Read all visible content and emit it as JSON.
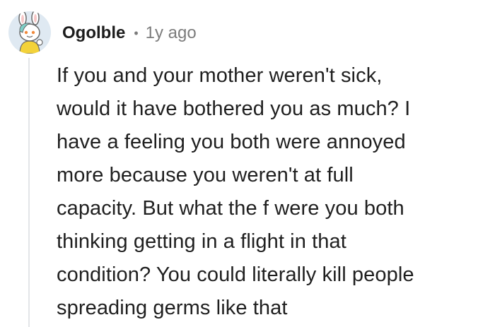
{
  "comment": {
    "author": "Ogolble",
    "separator": "•",
    "age": "1y ago",
    "avatar_icon": "snoo-avatar-icon",
    "lines": [
      "If you and your mother weren't sick,",
      "would it have bothered you as much? I",
      "have a feeling you both were annoyed",
      "more because you weren't at full",
      "capacity. But what the f were you both",
      "thinking getting in a flight in that",
      "condition? You could literally kill people",
      "spreading germs like that"
    ]
  },
  "colors": {
    "text": "#1f1f1f",
    "meta": "#7c7c7c",
    "thread_line": "#e3e5e8",
    "background": "#ffffff"
  }
}
